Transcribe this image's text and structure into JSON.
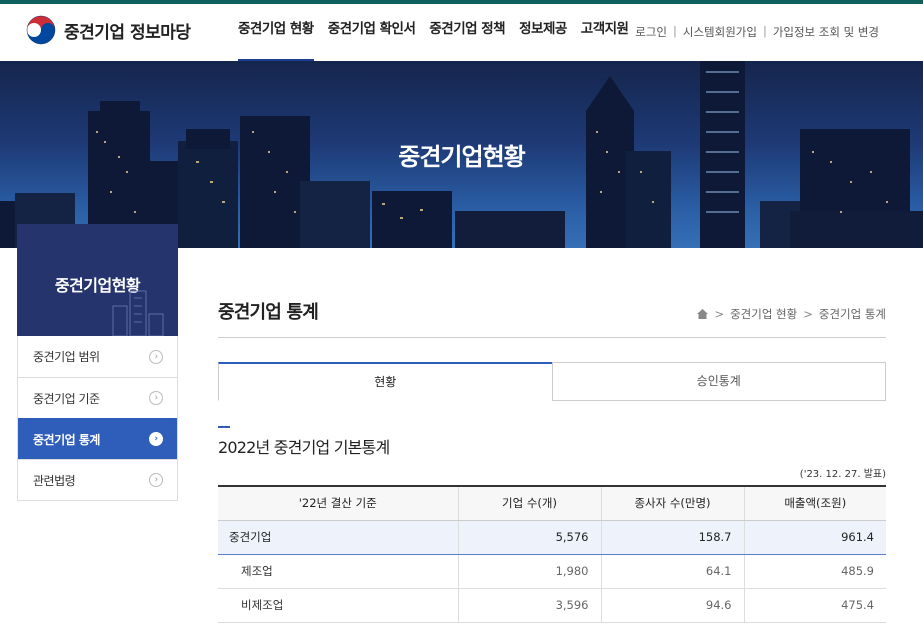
{
  "header": {
    "logo_text": "중견기업 정보마당",
    "nav": [
      "중견기업 현황",
      "중견기업 확인서",
      "중견기업 정책",
      "정보제공",
      "고객지원"
    ],
    "util": [
      "로그인",
      "시스템회원가입",
      "가입정보 조회 및 변경"
    ]
  },
  "hero": {
    "title": "중견기업현황"
  },
  "lnb": {
    "title": "중견기업현황",
    "items": [
      "중견기업 범위",
      "중견기업 기준",
      "중견기업 통계",
      "관련법령"
    ],
    "active_index": 2
  },
  "content": {
    "title": "중견기업 통계",
    "breadcrumb": [
      "중견기업 현황",
      "중견기업 통계"
    ],
    "tabs": [
      "현황",
      "승인통계"
    ],
    "section_title": "2022년 중견기업 기본통계",
    "note": "('23. 12. 27. 발표)",
    "table": {
      "headers": [
        "'22년 결산 기준",
        "기업 수(개)",
        "종사자 수(만명)",
        "매출액(조원)"
      ],
      "rows": [
        [
          "중견기업",
          "5,576",
          "158.7",
          "961.4"
        ],
        [
          "제조업",
          "1,980",
          "64.1",
          "485.9"
        ],
        [
          "비제조업",
          "3,596",
          "94.6",
          "475.4"
        ]
      ]
    }
  },
  "colors": {
    "accent": "#2f5dba",
    "lnb_head": "#25346c",
    "topline": "#0f5f5c"
  }
}
